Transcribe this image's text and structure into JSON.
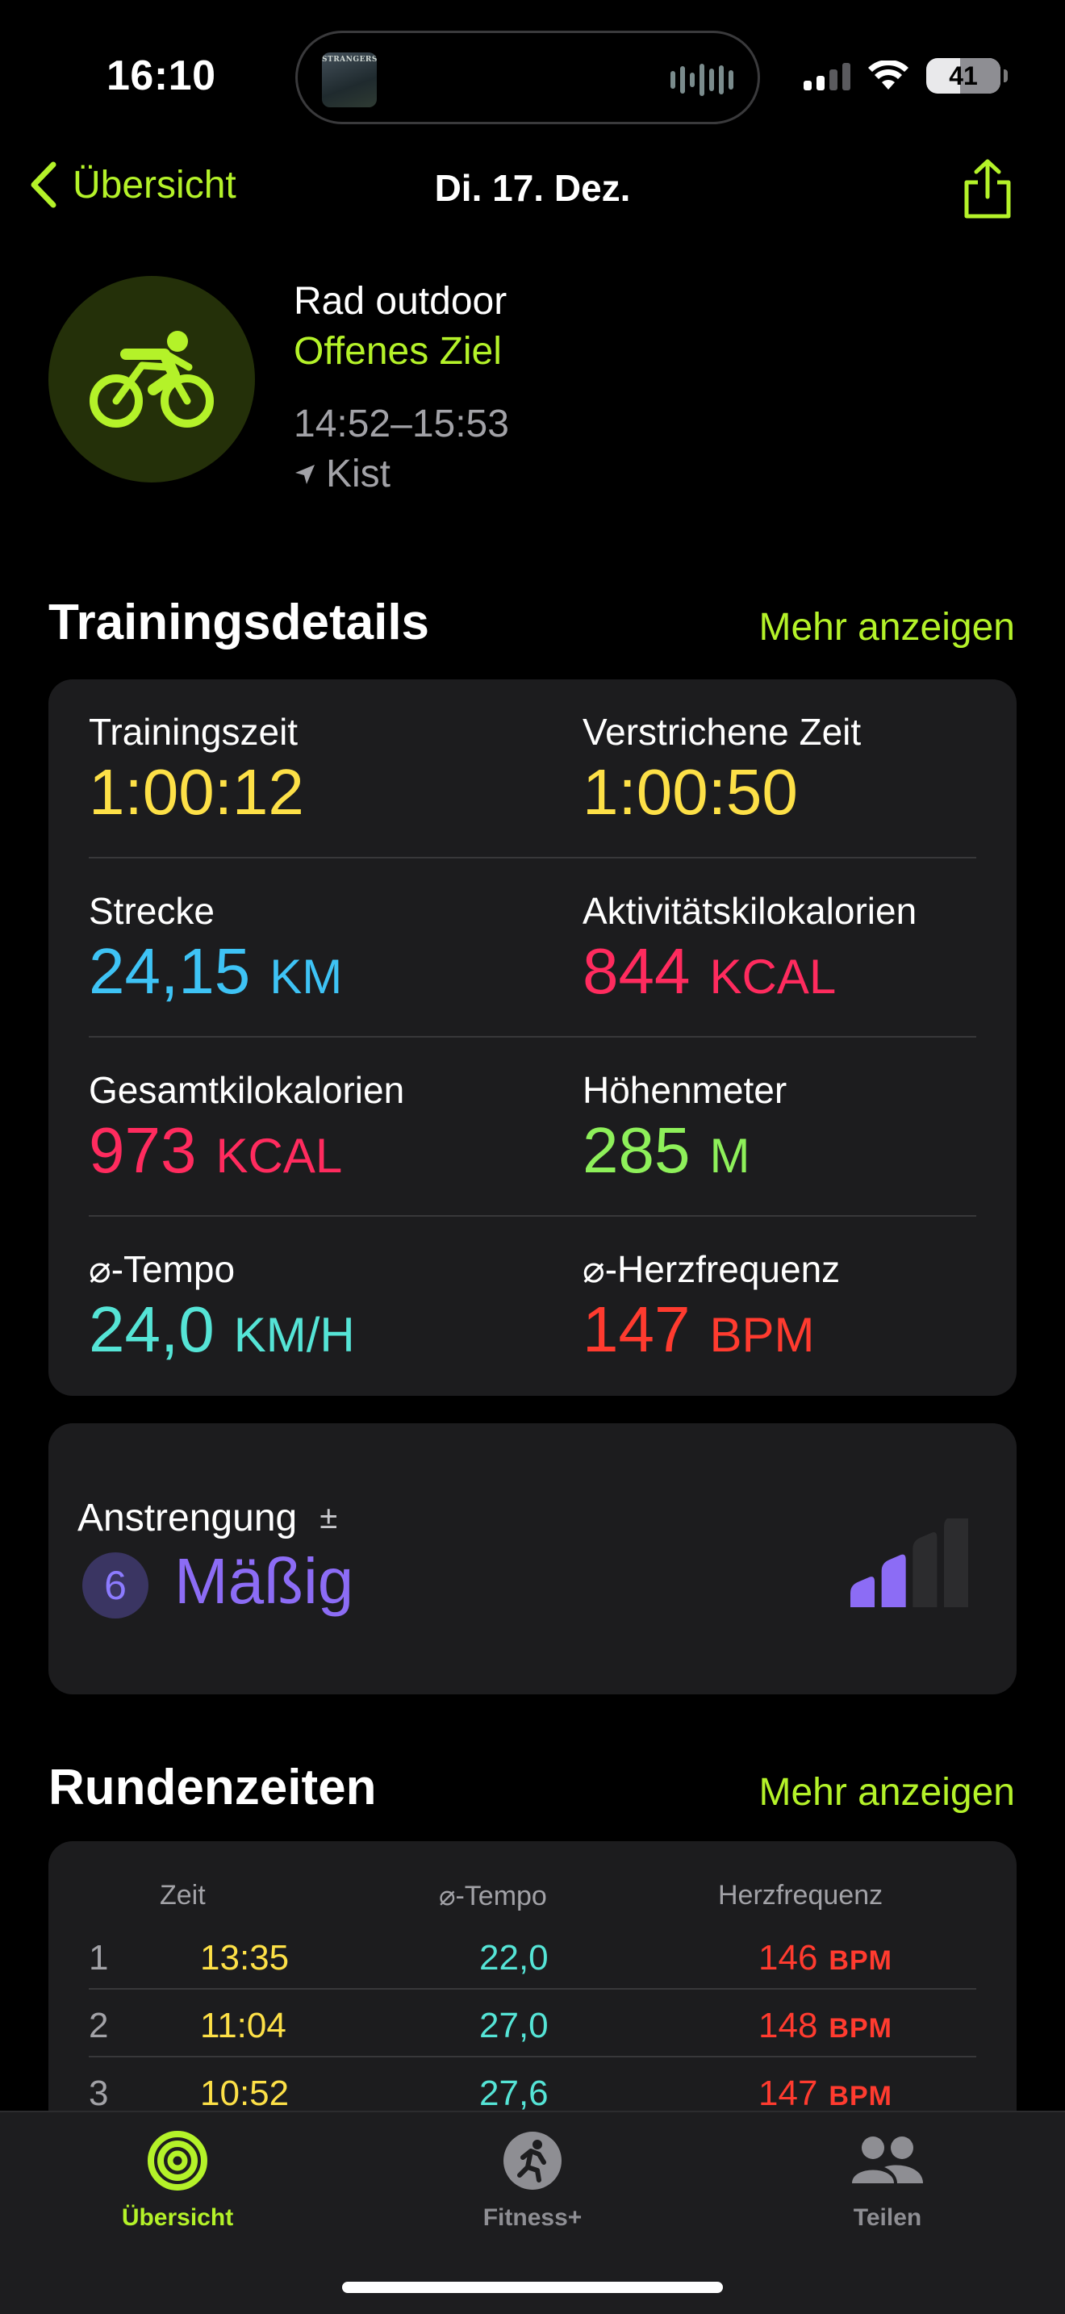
{
  "status": {
    "time": "16:10",
    "battery": "41",
    "now_playing_art_text": "STRANGERS"
  },
  "nav": {
    "back_label": "Übersicht",
    "title": "Di. 17. Dez."
  },
  "workout": {
    "type": "Rad outdoor",
    "goal": "Offenes Ziel",
    "time_range": "14:52–15:53",
    "location": "Kist"
  },
  "details": {
    "section_title": "Trainingsdetails",
    "more_label": "Mehr anzeigen",
    "metrics": [
      {
        "label": "Trainingszeit",
        "value": "1:00:12",
        "unit": "",
        "color": "#fde047"
      },
      {
        "label": "Verstrichene Zeit",
        "value": "1:00:50",
        "unit": "",
        "color": "#fde047"
      },
      {
        "label": "Strecke",
        "value": "24,15",
        "unit": "KM",
        "color": "#3ec3f5"
      },
      {
        "label": "Aktivitätskilokalorien",
        "value": "844",
        "unit": "KCAL",
        "color": "#ff2b5e"
      },
      {
        "label": "Gesamtkilokalorien",
        "value": "973",
        "unit": "KCAL",
        "color": "#ff2b5e"
      },
      {
        "label": "Höhenmeter",
        "value": "285",
        "unit": "M",
        "color": "#8ef05a"
      },
      {
        "label": "⌀-Tempo",
        "value": "24,0",
        "unit": "KM/H",
        "color": "#55e4d6"
      },
      {
        "label": "⌀-Herzfrequenz",
        "value": "147",
        "unit": "BPM",
        "color": "#ff3b2f"
      }
    ]
  },
  "effort": {
    "label": "Anstrengung",
    "adjust_symbol": "±",
    "score": "6",
    "value": "Mäßig",
    "level_bars_filled": 2,
    "level_bars_total": 4,
    "color": "#8c6cf5"
  },
  "laps": {
    "section_title": "Rundenzeiten",
    "more_label": "Mehr anzeigen",
    "headers": {
      "time": "Zeit",
      "pace": "⌀-Tempo",
      "hr": "Herzfrequenz"
    },
    "hr_unit": "BPM",
    "rows": [
      {
        "n": "1",
        "time": "13:35",
        "pace": "22,0",
        "hr": "146"
      },
      {
        "n": "2",
        "time": "11:04",
        "pace": "27,0",
        "hr": "148"
      },
      {
        "n": "3",
        "time": "10:52",
        "pace": "27,6",
        "hr": "147"
      }
    ]
  },
  "tabbar": {
    "tabs": [
      {
        "label": "Übersicht",
        "icon": "activity-rings-icon",
        "active": true
      },
      {
        "label": "Fitness+",
        "icon": "fitness-plus-icon",
        "active": false
      },
      {
        "label": "Teilen",
        "icon": "people-icon",
        "active": false
      }
    ]
  },
  "colors": {
    "accent": "#b4f229",
    "background": "#000000",
    "card": "#1c1c1e"
  }
}
